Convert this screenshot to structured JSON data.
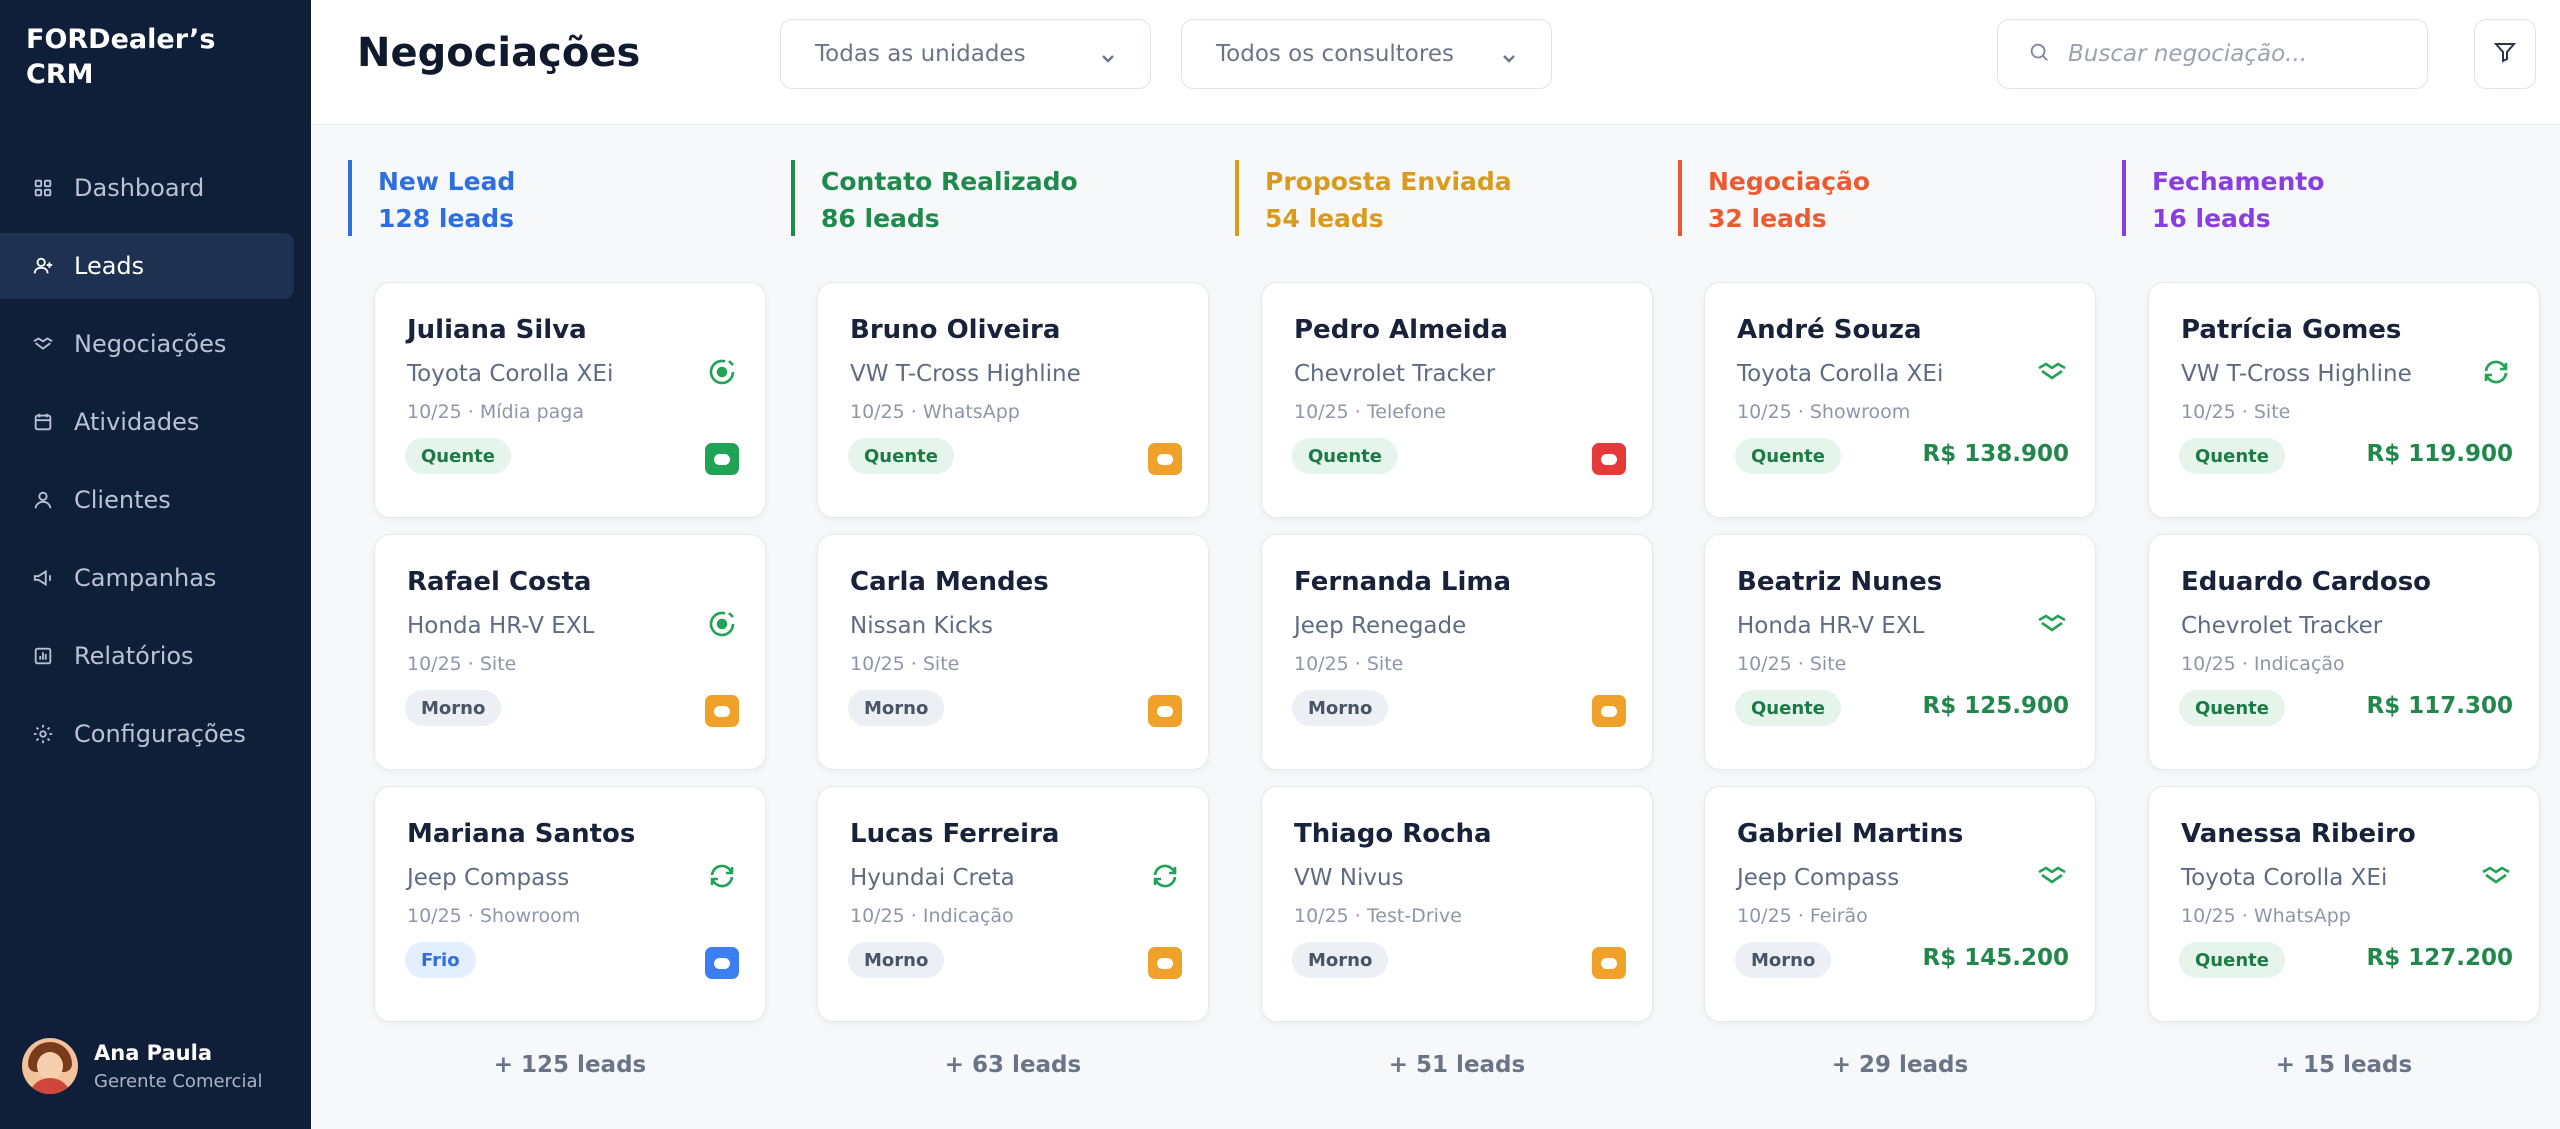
{
  "app": {
    "brand": "FORDealer’s CRM"
  },
  "sidebar": {
    "items": [
      {
        "label": "Dashboard",
        "icon": "grid-icon"
      },
      {
        "label": "Leads",
        "icon": "user-plus-icon",
        "active": true
      },
      {
        "label": "Negociações",
        "icon": "handshake-icon"
      },
      {
        "label": "Atividades",
        "icon": "calendar-icon"
      },
      {
        "label": "Clientes",
        "icon": "user-icon"
      },
      {
        "label": "Campanhas",
        "icon": "megaphone-icon"
      },
      {
        "label": "Relatórios",
        "icon": "chart-icon"
      },
      {
        "label": "Configurações",
        "icon": "gear-icon"
      }
    ],
    "user": {
      "name": "Ana Paula",
      "role": "Gerente Comercial"
    }
  },
  "header": {
    "title": "Negociações",
    "units_select": "Todas as unidades",
    "consultants_select": "Todos os consultores",
    "search_placeholder": "Buscar negociação..."
  },
  "colors": {
    "new": "#2d6fe0",
    "contato": "#1e8a4c",
    "proposta": "#d99a1e",
    "negociacao": "#ee5a2f",
    "fechamento": "#8a3ee0",
    "chat_green": "#21a355",
    "chat_orange": "#f0a12a",
    "chat_red": "#e5393b",
    "chat_blue": "#3b7ff0"
  },
  "columns": [
    {
      "title": "New Lead",
      "count": "128 leads",
      "color": "#2d6fe0",
      "more": "+ 125 leads",
      "cards": [
        {
          "name": "Juliana Silva",
          "car": "Toyota Corolla XEi",
          "meta": "10/25 · Mídia paga",
          "temp": "Quente",
          "temp_class": "hot",
          "icon": "target-icon",
          "chat": "#21a355"
        },
        {
          "name": "Rafael Costa",
          "car": "Honda HR-V EXL",
          "meta": "10/25 · Site",
          "temp": "Morno",
          "temp_class": "warm",
          "icon": "target-icon",
          "chat": "#f0a12a"
        },
        {
          "name": "Mariana Santos",
          "car": "Jeep Compass",
          "meta": "10/25 · Showroom",
          "temp": "Frio",
          "temp_class": "cold",
          "icon": "refresh-icon",
          "chat": "#3b7ff0"
        }
      ]
    },
    {
      "title": "Contato Realizado",
      "count": "86 leads",
      "color": "#1e8a4c",
      "more": "+ 63 leads",
      "cards": [
        {
          "name": "Bruno Oliveira",
          "car": "VW T-Cross Highline",
          "meta": "10/25 · WhatsApp",
          "temp": "Quente",
          "temp_class": "hot",
          "icon": "",
          "chat": "#f0a12a"
        },
        {
          "name": "Carla Mendes",
          "car": "Nissan Kicks",
          "meta": "10/25 · Site",
          "temp": "Morno",
          "temp_class": "warm",
          "icon": "",
          "chat": "#f0a12a"
        },
        {
          "name": "Lucas Ferreira",
          "car": "Hyundai Creta",
          "meta": "10/25 · Indicação",
          "temp": "Morno",
          "temp_class": "warm",
          "icon": "refresh-icon",
          "chat": "#f0a12a"
        }
      ]
    },
    {
      "title": "Proposta Enviada",
      "count": "54 leads",
      "color": "#d99a1e",
      "more": "+ 51 leads",
      "cards": [
        {
          "name": "Pedro Almeida",
          "car": "Chevrolet Tracker",
          "meta": "10/25 · Telefone",
          "temp": "Quente",
          "temp_class": "hot",
          "icon": "",
          "chat": "#e5393b"
        },
        {
          "name": "Fernanda Lima",
          "car": "Jeep Renegade",
          "meta": "10/25 · Site",
          "temp": "Morno",
          "temp_class": "warm",
          "icon": "",
          "chat": "#f0a12a"
        },
        {
          "name": "Thiago Rocha",
          "car": "VW Nivus",
          "meta": "10/25 · Test-Drive",
          "temp": "Morno",
          "temp_class": "warm",
          "icon": "",
          "chat": "#f0a12a"
        }
      ]
    },
    {
      "title": "Negociação",
      "count": "32 leads",
      "color": "#ee5a2f",
      "more": "+ 29 leads",
      "cards": [
        {
          "name": "André Souza",
          "car": "Toyota Corolla XEi",
          "meta": "10/25 · Showroom",
          "temp": "Quente",
          "temp_class": "hot",
          "icon": "handshake-icon",
          "price": "R$ 138.900"
        },
        {
          "name": "Beatriz Nunes",
          "car": "Honda HR-V EXL",
          "meta": "10/25 · Site",
          "temp": "Quente",
          "temp_class": "hot",
          "icon": "handshake-icon",
          "price": "R$ 125.900"
        },
        {
          "name": "Gabriel Martins",
          "car": "Jeep Compass",
          "meta": "10/25 · Feirão",
          "temp": "Morno",
          "temp_class": "warm",
          "icon": "handshake-icon",
          "price": "R$ 145.200"
        }
      ]
    },
    {
      "title": "Fechamento",
      "count": "16 leads",
      "color": "#8a3ee0",
      "more": "+ 15 leads",
      "cards": [
        {
          "name": "Patrícia Gomes",
          "car": "VW T-Cross Highline",
          "meta": "10/25 · Site",
          "temp": "Quente",
          "temp_class": "hot",
          "icon": "refresh-icon",
          "price": "R$ 119.900"
        },
        {
          "name": "Eduardo Cardoso",
          "car": "Chevrolet Tracker",
          "meta": "10/25 · Indicação",
          "temp": "Quente",
          "temp_class": "hot",
          "icon": "",
          "price": "R$ 117.300"
        },
        {
          "name": "Vanessa Ribeiro",
          "car": "Toyota Corolla XEi",
          "meta": "10/25 · WhatsApp",
          "temp": "Quente",
          "temp_class": "hot",
          "icon": "handshake-icon",
          "price": "R$ 127.200"
        }
      ]
    }
  ]
}
